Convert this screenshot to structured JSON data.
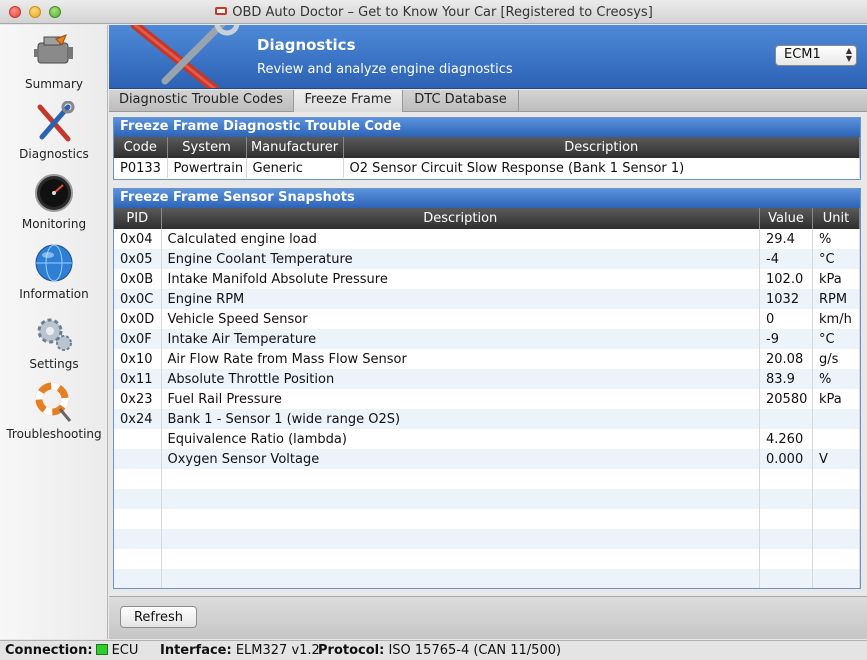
{
  "window": {
    "title": "OBD Auto Doctor – Get to Know Your Car [Registered to Creosys]"
  },
  "sidebar": {
    "items": [
      {
        "label": "Summary",
        "icon": "engine-icon"
      },
      {
        "label": "Diagnostics",
        "icon": "tools-icon"
      },
      {
        "label": "Monitoring",
        "icon": "gauge-icon"
      },
      {
        "label": "Information",
        "icon": "globe-icon"
      },
      {
        "label": "Settings",
        "icon": "gear-icon"
      },
      {
        "label": "Troubleshooting",
        "icon": "lifebuoy-icon"
      }
    ]
  },
  "header": {
    "title": "Diagnostics",
    "subtitle": "Review and analyze engine diagnostics",
    "ecu_selected": "ECM1"
  },
  "tabs": [
    {
      "label": "Diagnostic Trouble Codes",
      "active": false
    },
    {
      "label": "Freeze Frame",
      "active": true
    },
    {
      "label": "DTC Database",
      "active": false
    }
  ],
  "dtc_panel": {
    "title": "Freeze Frame Diagnostic Trouble Code",
    "columns": [
      "Code",
      "System",
      "Manufacturer",
      "Description"
    ],
    "rows": [
      [
        "P0133",
        "Powertrain",
        "Generic",
        "O2 Sensor Circuit Slow Response (Bank 1 Sensor 1)"
      ]
    ]
  },
  "snapshot_panel": {
    "title": "Freeze Frame Sensor Snapshots",
    "columns": [
      "PID",
      "Description",
      "Value",
      "Unit"
    ],
    "rows": [
      [
        "0x04",
        "Calculated engine load",
        "29.4",
        "%"
      ],
      [
        "0x05",
        "Engine Coolant Temperature",
        "-4",
        "°C"
      ],
      [
        "0x0B",
        "Intake Manifold Absolute Pressure",
        "102.0",
        "kPa"
      ],
      [
        "0x0C",
        "Engine RPM",
        "1032",
        "RPM"
      ],
      [
        "0x0D",
        "Vehicle Speed Sensor",
        "0",
        "km/h"
      ],
      [
        "0x0F",
        "Intake Air Temperature",
        "-9",
        "°C"
      ],
      [
        "0x10",
        "Air Flow Rate from Mass Flow Sensor",
        "20.08",
        "g/s"
      ],
      [
        "0x11",
        "Absolute Throttle Position",
        "83.9",
        "%"
      ],
      [
        "0x23",
        "Fuel Rail Pressure",
        "20580",
        "kPa"
      ],
      [
        "0x24",
        "Bank 1 - Sensor 1 (wide range O2S)",
        "",
        ""
      ],
      [
        "",
        "Equivalence Ratio (lambda)",
        "4.260",
        ""
      ],
      [
        "",
        "Oxygen Sensor Voltage",
        "0.000",
        "V"
      ]
    ],
    "empty_rows": 6
  },
  "toolbar": {
    "refresh_label": "Refresh"
  },
  "status": {
    "connection_label": "Connection:",
    "connection_value": "ECU",
    "connection_color": "#2ecc2e",
    "interface_label": "Interface:",
    "interface_value": "ELM327 v1.2",
    "protocol_label": "Protocol:",
    "protocol_value": "ISO 15765-4 (CAN 11/500)"
  }
}
